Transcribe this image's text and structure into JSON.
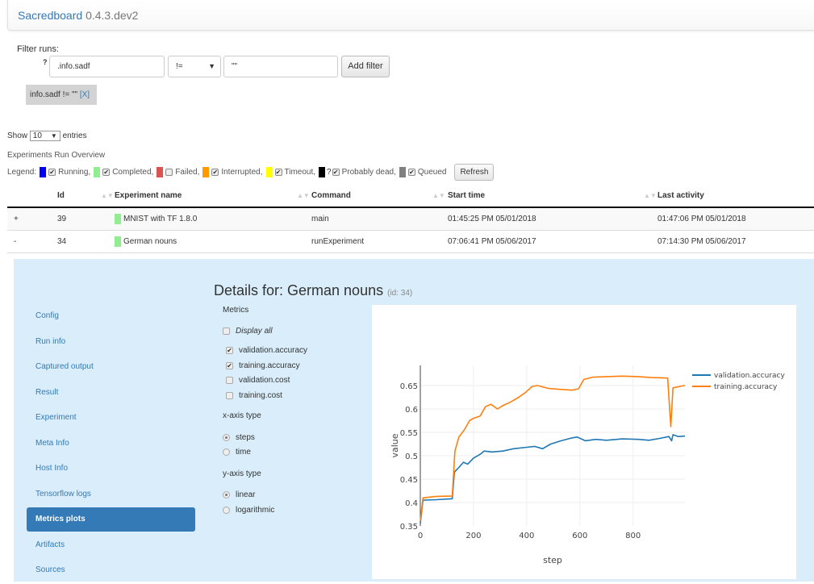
{
  "navbar": {
    "brand_name": "Sacredboard",
    "version": "0.4.3.dev2"
  },
  "filter": {
    "label": "Filter runs:",
    "help_mark": "?",
    "field_value": ".info.sadf",
    "operator_value": "!=",
    "operator_arrow": "▼",
    "value_value": "\"\"",
    "add_button": "Add filter",
    "active_filter": {
      "text": "info.sadf != \"\"",
      "remove": "[X]"
    }
  },
  "entries": {
    "prefix": "Show",
    "value": "10",
    "arrow": "▼",
    "suffix": "entries"
  },
  "overview": {
    "title": "Experiments Run Overview",
    "legend_label": "Legend:",
    "legend": [
      {
        "label": "Running,",
        "color": "#0000ff",
        "checked": true,
        "prefix": ""
      },
      {
        "label": "Completed,",
        "color": "#90ee90",
        "checked": true,
        "prefix": ""
      },
      {
        "label": "Failed,",
        "color": "#d9534f",
        "checked": false,
        "prefix": ""
      },
      {
        "label": "Interrupted,",
        "color": "#ff9900",
        "checked": true,
        "prefix": ""
      },
      {
        "label": "Timeout,",
        "color": "#ffff00",
        "checked": true,
        "prefix": ""
      },
      {
        "label": "Probably dead,",
        "color": "#000000",
        "checked": true,
        "prefix": "?"
      },
      {
        "label": "Queued",
        "color": "#808080",
        "checked": true,
        "prefix": ""
      }
    ],
    "refresh_button": "Refresh"
  },
  "table": {
    "columns": [
      "",
      "Id",
      "Experiment name",
      "Command",
      "Start time",
      "Last activity"
    ],
    "rows": [
      {
        "toggle": "+",
        "id": "39",
        "name": "MNIST with TF 1.8.0",
        "command": "main",
        "start": "01:45:25 PM 05/01/2018",
        "last": "01:47:06 PM 05/01/2018",
        "status_color": "#90ee90"
      },
      {
        "toggle": "-",
        "id": "34",
        "name": "German nouns",
        "command": "runExperiment",
        "start": "07:06:41 PM 05/06/2017",
        "last": "07:14:30 PM 05/06/2017",
        "status_color": "#90ee90"
      }
    ]
  },
  "details": {
    "title": "Details for: German nouns",
    "id_note": "(id: 34)",
    "nav": [
      {
        "label": "Config",
        "active": false
      },
      {
        "label": "Run info",
        "active": false
      },
      {
        "label": "Captured output",
        "active": false
      },
      {
        "label": "Result",
        "active": false
      },
      {
        "label": "Experiment",
        "active": false
      },
      {
        "label": "Meta Info",
        "active": false
      },
      {
        "label": "Host Info",
        "active": false
      },
      {
        "label": "Tensorflow logs",
        "active": false
      },
      {
        "label": "Metrics plots",
        "active": true
      },
      {
        "label": "Artifacts",
        "active": false
      },
      {
        "label": "Sources",
        "active": false
      }
    ],
    "metrics": {
      "heading": "Metrics",
      "display_all": {
        "label": "Display all",
        "checked": false
      },
      "items": [
        {
          "label": "validation.accuracy",
          "checked": true
        },
        {
          "label": "training.accuracy",
          "checked": true
        },
        {
          "label": "validation.cost",
          "checked": false
        },
        {
          "label": "training.cost",
          "checked": false
        }
      ],
      "x_axis": {
        "heading": "x-axis type",
        "options": [
          {
            "label": "steps",
            "selected": true
          },
          {
            "label": "time",
            "selected": false
          }
        ]
      },
      "y_axis": {
        "heading": "y-axis type",
        "options": [
          {
            "label": "linear",
            "selected": true
          },
          {
            "label": "logarithmic",
            "selected": false
          }
        ]
      }
    }
  },
  "chart_data": {
    "type": "line",
    "title": "",
    "xlabel": "step",
    "ylabel": "value",
    "xlim": [
      0,
      995
    ],
    "ylim": [
      0.35,
      0.693
    ],
    "xticks": [
      0,
      200,
      400,
      600,
      800
    ],
    "xtick_labels": [
      "0",
      "200",
      "400",
      "600",
      "800"
    ],
    "yticks": [
      0.35,
      0.4,
      0.45,
      0.5,
      0.55,
      0.6,
      0.65
    ],
    "ytick_labels": [
      "0.35",
      "0.4",
      "0.45",
      "0.5",
      "0.55",
      "0.6",
      "0.65"
    ],
    "grid": true,
    "legend_position": "top-right",
    "series": [
      {
        "name": "validation.accuracy",
        "color": "#1f77b4",
        "x": [
          0,
          10,
          60,
          120,
          128,
          145,
          162,
          178,
          200,
          225,
          240,
          270,
          310,
          350,
          400,
          430,
          460,
          490,
          530,
          570,
          590,
          620,
          660,
          700,
          760,
          820,
          860,
          900,
          935,
          945,
          950,
          970,
          995
        ],
        "y": [
          0.355,
          0.405,
          0.406,
          0.408,
          0.465,
          0.475,
          0.486,
          0.482,
          0.495,
          0.503,
          0.51,
          0.508,
          0.51,
          0.515,
          0.518,
          0.52,
          0.515,
          0.525,
          0.532,
          0.538,
          0.54,
          0.532,
          0.535,
          0.533,
          0.536,
          0.535,
          0.533,
          0.537,
          0.541,
          0.532,
          0.545,
          0.541,
          0.542
        ]
      },
      {
        "name": "training.accuracy",
        "color": "#ff7f0e",
        "x": [
          0,
          10,
          60,
          120,
          130,
          145,
          165,
          185,
          200,
          225,
          245,
          265,
          290,
          310,
          340,
          370,
          395,
          420,
          440,
          480,
          520,
          570,
          595,
          615,
          650,
          700,
          760,
          820,
          870,
          930,
          942,
          950,
          975,
          995
        ],
        "y": [
          0.36,
          0.41,
          0.413,
          0.414,
          0.51,
          0.54,
          0.555,
          0.575,
          0.58,
          0.585,
          0.605,
          0.61,
          0.6,
          0.607,
          0.615,
          0.625,
          0.635,
          0.648,
          0.65,
          0.644,
          0.642,
          0.64,
          0.643,
          0.663,
          0.668,
          0.669,
          0.67,
          0.669,
          0.667,
          0.666,
          0.562,
          0.645,
          0.648,
          0.65
        ]
      }
    ]
  }
}
